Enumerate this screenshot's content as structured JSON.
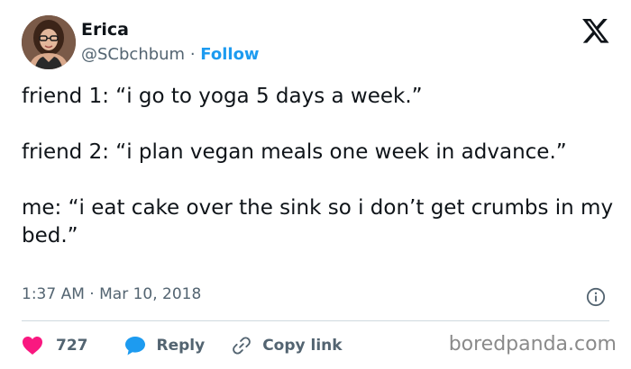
{
  "author": {
    "name": "Erica",
    "handle": "@SCbchbum",
    "separator": "·",
    "follow_label": "Follow",
    "avatar_icon": "profile-photo"
  },
  "brand": {
    "logo_icon": "x-logo"
  },
  "tweet": {
    "paragraphs": [
      "friend 1: “i go to yoga 5 days a week.”",
      "friend 2: “i plan vegan meals one week in advance.”",
      "me: “i eat cake over the sink so i don’t get crumbs in my bed.”"
    ],
    "time": "1:37 AM",
    "separator": "·",
    "date": "Mar 10, 2018"
  },
  "actions": {
    "like_count": "727",
    "reply_label": "Reply",
    "copy_link_label": "Copy link"
  },
  "watermark": "boredpanda.com",
  "colors": {
    "like": "#f91880",
    "reply": "#1d9bf0",
    "follow": "#1d9bf0",
    "text": "#0f1419",
    "muted": "#536471"
  }
}
